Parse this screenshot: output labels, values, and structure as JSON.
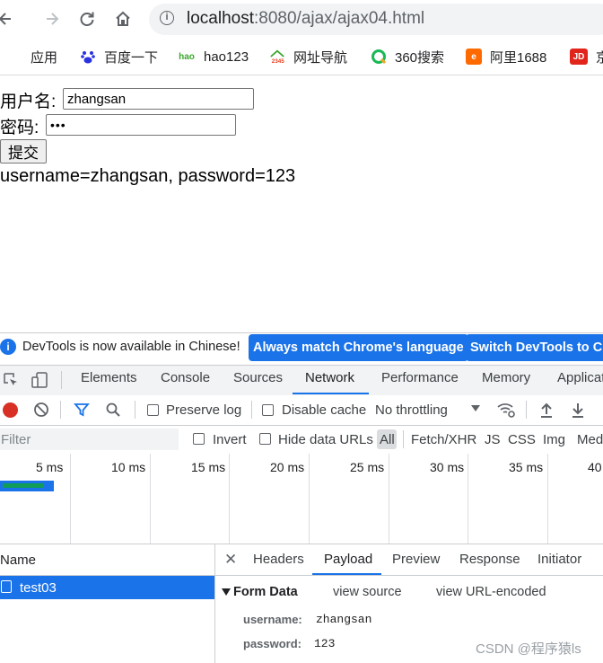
{
  "browser": {
    "url_host": "localhost",
    "url_rest": ":8080/ajax/ajax04.html",
    "bookmarks": [
      {
        "label": "应用",
        "icon": "apps-grid-icon"
      },
      {
        "label": "百度一下",
        "icon": "baidu-paw-icon"
      },
      {
        "label": "hao123",
        "icon": "hao123-icon"
      },
      {
        "label": "网址导航",
        "icon": "2345-icon"
      },
      {
        "label": "360搜索",
        "icon": "360-icon"
      },
      {
        "label": "阿里1688",
        "icon": "alibaba-icon"
      },
      {
        "label": "京",
        "icon": "jd-icon"
      }
    ],
    "colors": {
      "accent": "#1a73e8"
    }
  },
  "form": {
    "username_label": "用户名:",
    "username_value": "zhangsan",
    "password_label": "密码:",
    "password_mask": "•••",
    "submit_label": "提交",
    "result_text": "username=zhangsan, password=123"
  },
  "devtools": {
    "banner_text": "DevTools is now available in Chinese!",
    "banner_btn1": "Always match Chrome's language",
    "banner_btn2": "Switch DevTools to Ch",
    "tabs": [
      "Elements",
      "Console",
      "Sources",
      "Network",
      "Performance",
      "Memory",
      "Applicati"
    ],
    "active_tab": "Network",
    "network_toolbar": {
      "preserve_log": "Preserve log",
      "disable_cache": "Disable cache",
      "throttling": "No throttling"
    },
    "filter": {
      "placeholder": "Filter",
      "invert": "Invert",
      "hide_data_urls": "Hide data URLs",
      "types": [
        "All",
        "Fetch/XHR",
        "JS",
        "CSS",
        "Img",
        "Med"
      ]
    },
    "timeline_labels": [
      "5 ms",
      "10 ms",
      "15 ms",
      "20 ms",
      "25 ms",
      "30 ms",
      "35 ms",
      "40"
    ],
    "requests": {
      "header": "Name",
      "rows": [
        {
          "name": "test03",
          "selected": true
        }
      ]
    },
    "detail_tabs": [
      "Headers",
      "Payload",
      "Preview",
      "Response",
      "Initiator"
    ],
    "active_detail_tab": "Payload",
    "payload": {
      "section_title": "Form Data",
      "view_source": "view source",
      "view_url_encoded": "view URL-encoded",
      "fields": [
        {
          "key": "username:",
          "value": "zhangsan"
        },
        {
          "key": "password:",
          "value": "123"
        }
      ]
    },
    "watermark": "CSDN @程序猿ls"
  }
}
